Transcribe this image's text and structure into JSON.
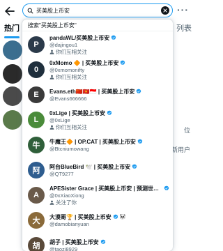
{
  "search": {
    "value": "买美股上币安"
  },
  "dropdown": {
    "search_for": "搜索\"买美股上币安\""
  },
  "background": {
    "tab_hot": "热门",
    "tab_list": "列表",
    "edge_texts": [
      "位",
      "新用户"
    ]
  },
  "results": [
    {
      "name": "pandaWL/买美股上币安",
      "handle": "@dajingou1",
      "followed": "你们互相关注",
      "avatar_color": "#2b3a4a",
      "avatar_letter": "P"
    },
    {
      "name": "0xMomo 🔶 | 买美股上币安",
      "handle": "@0xmomonifty",
      "followed": "你们互相关注",
      "avatar_color": "#1f2f3d",
      "avatar_letter": "0"
    },
    {
      "name": "Evans.eth🇨🇳🇻🇳🇮🇩 | 买美股上币安",
      "handle": "@Evans666666",
      "followed": "",
      "avatar_color": "#3a3a3a",
      "avatar_letter": "E"
    },
    {
      "name": "0xLige | 买美股上币安",
      "handle": "@0xLige",
      "followed": "你们互相关注",
      "avatar_color": "#4a8b3a",
      "avatar_letter": "L"
    },
    {
      "name": "牛魔王🔶 | OP.CAT | 买美股上币安",
      "handle": "@Btcniumowang",
      "followed": "",
      "avatar_color": "#2f5f3a",
      "avatar_letter": "牛"
    },
    {
      "name": "阿台BlueBird 🕊️ | 买美股上币安",
      "handle": "@QT9277",
      "followed": "",
      "avatar_color": "#2e5d8f",
      "avatar_letter": "阿"
    },
    {
      "name": "APESister Grace | 买美股上币安 | 预测世界杯就...",
      "handle": "@0xXiaoXiong",
      "followed": "关注了你",
      "avatar_color": "#6a5a4a",
      "avatar_letter": "A"
    },
    {
      "name": "大漠哥🏆 | 买美股上币安",
      "handle": "@damobianyuan",
      "followed": "",
      "avatar_color": "#8a6a3a",
      "avatar_letter": "大",
      "extra": "🐼"
    },
    {
      "name": "胡子 | 买美股上币安",
      "handle": "@taozi8929",
      "followed": "",
      "avatar_color": "#5a4a3a",
      "avatar_letter": "胡"
    }
  ],
  "colors": {
    "accent": "#1d9bf0",
    "verified": "#1d9bf0"
  }
}
